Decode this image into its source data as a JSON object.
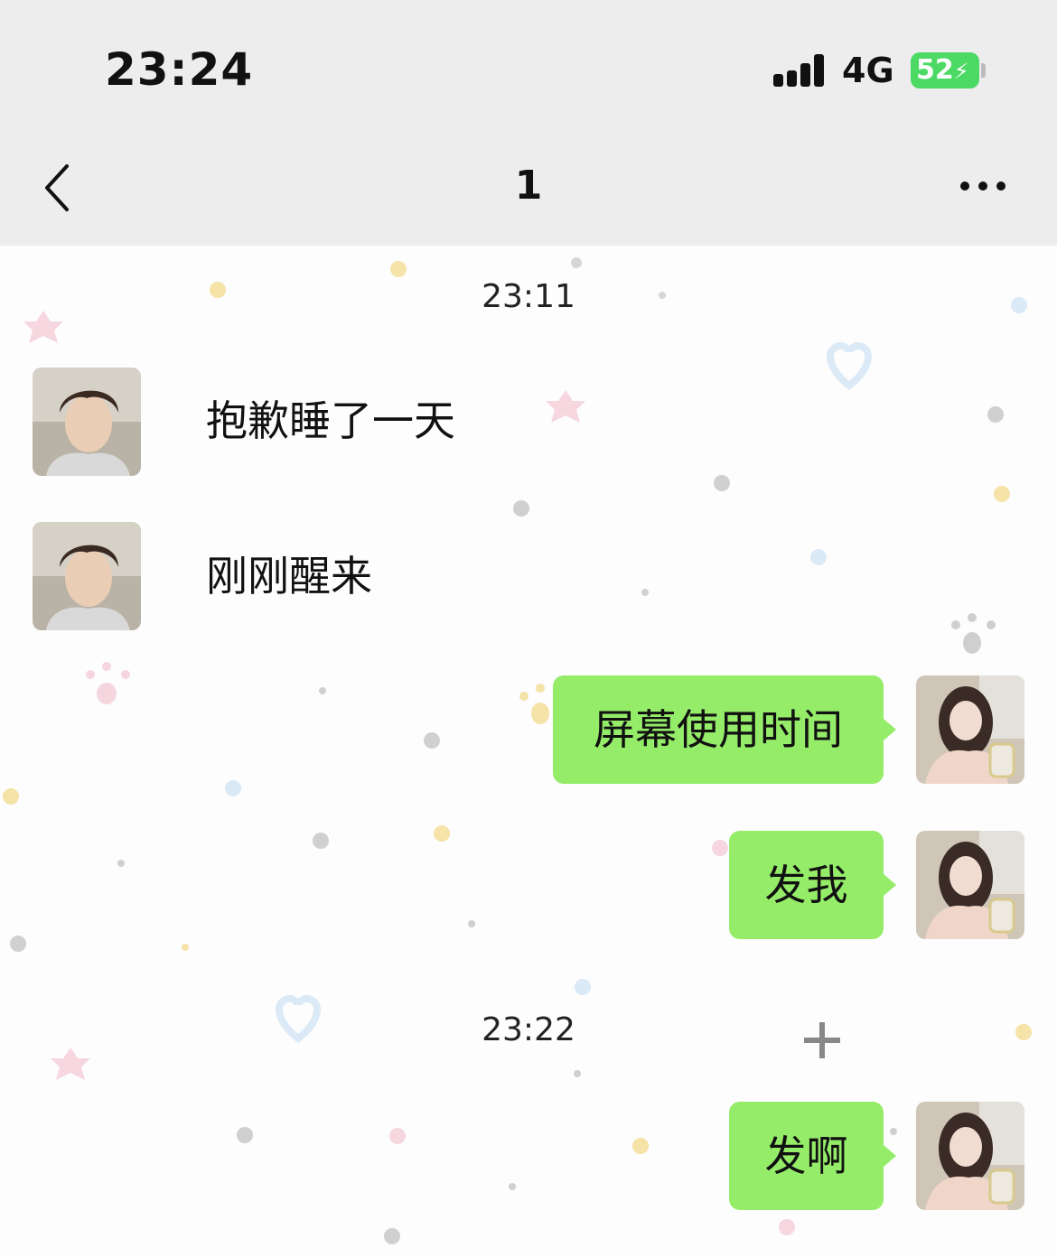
{
  "status_bar": {
    "time": "23:24",
    "network": "4G",
    "battery": "52"
  },
  "nav": {
    "title": "1",
    "back_icon": "chevron-left-icon",
    "more_icon": "ellipsis-icon"
  },
  "messages": [
    {
      "type": "timestamp",
      "text": "23:11"
    },
    {
      "type": "received",
      "text": "抱歉睡了一天"
    },
    {
      "type": "received",
      "text": "刚刚醒来"
    },
    {
      "type": "sent",
      "text": "屏幕使用时间"
    },
    {
      "type": "sent",
      "text": "发我"
    },
    {
      "type": "timestamp",
      "text": "23:22"
    },
    {
      "type": "sent",
      "text": "发啊"
    }
  ],
  "colors": {
    "header_bg": "#ededed",
    "sent_bubble": "#95ec69",
    "battery": "#4cd964"
  }
}
